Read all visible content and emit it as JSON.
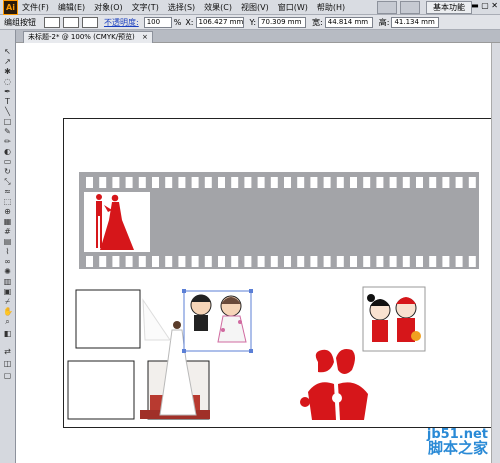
{
  "menubar": {
    "logo": "Ai",
    "items": [
      "文件(F)",
      "编辑(E)",
      "对象(O)",
      "文字(T)",
      "选择(S)",
      "效果(C)",
      "视图(V)",
      "窗口(W)",
      "帮助(H)"
    ],
    "workspace": "基本功能"
  },
  "options_bar": {
    "selection_label": "编组按钮",
    "opacity_label": "不透明度:",
    "opacity_value": "100",
    "opacity_unit": "%",
    "x_label": "X:",
    "x_value": "106.427 mm",
    "y_label": "Y:",
    "y_value": "70.309 mm",
    "w_label": "宽:",
    "w_value": "44.814 mm",
    "h_label": "高:",
    "h_value": "41.134 mm"
  },
  "document_tab": {
    "title": "未标题-2* @ 100% (CMYK/预览)",
    "close": "×"
  },
  "watermark": {
    "url": "jb51.net",
    "site": "脚本之家"
  },
  "colors": {
    "film_strip": "#a3a4a8",
    "wedding_red": "#d6161a",
    "canvas_bg": "#ffffff"
  }
}
